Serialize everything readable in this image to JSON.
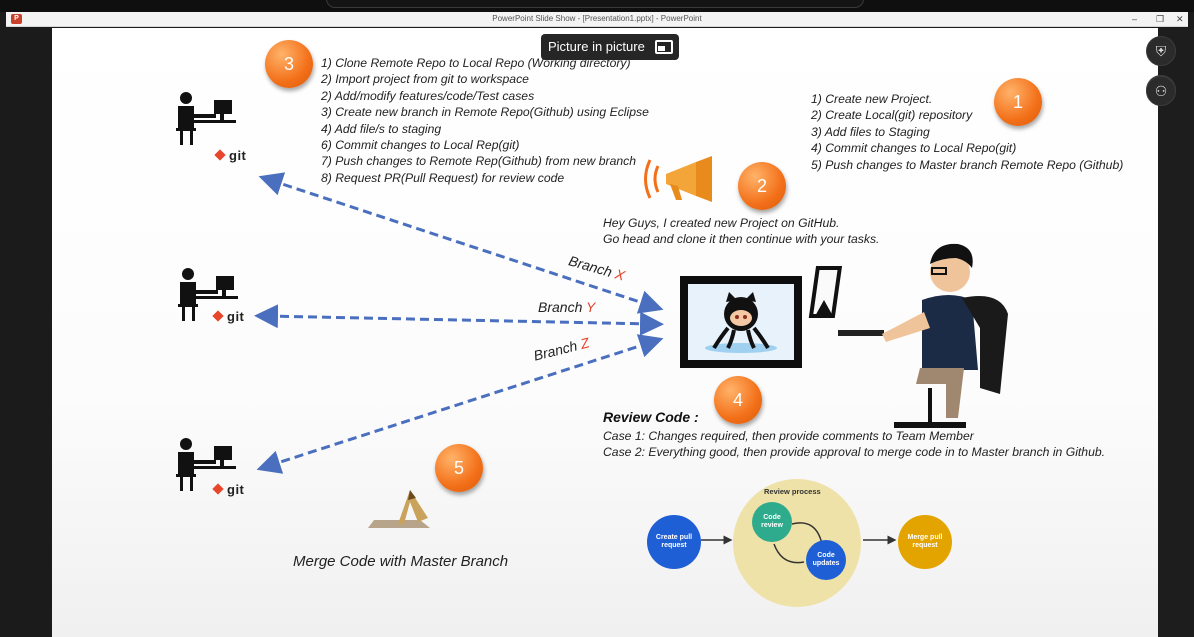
{
  "window": {
    "title": "PowerPoint Slide Show - [Presentation1.pptx] - PowerPoint",
    "app_icon_letter": "P"
  },
  "pip_button": {
    "label": "Picture in picture",
    "icon": "picture-in-picture-icon"
  },
  "side_buttons": [
    {
      "icon": "shield-icon"
    },
    {
      "icon": "plus-icon"
    },
    {
      "icon": "user-add-icon"
    }
  ],
  "slide": {
    "badges": [
      "1",
      "2",
      "3",
      "4",
      "5"
    ],
    "steps_right": [
      "1) Create new Project.",
      "2) Create Local(git) repository",
      "3) Add files to Staging",
      "4) Commit changes to Local Repo(git)",
      "5) Push changes to Master branch Remote Repo (Github)"
    ],
    "steps_left": [
      "1) Clone Remote Repo to Local Repo (Working directory)",
      "2) Import project from git to workspace",
      "2) Add/modify features/code/Test cases",
      "3) Create new branch in Remote Repo(Github) using Eclipse",
      "4) Add file/s to staging",
      "6) Commit changes to Local Rep(git)",
      "7) Push changes to Remote Rep(Github) from new branch",
      "8) Request PR(Pull Request) for review code"
    ],
    "announcement": [
      "Hey Guys, I created new Project on GitHub.",
      "Go head and clone it then continue with your tasks."
    ],
    "git_label": "git",
    "branches": [
      {
        "word": "Branch",
        "letter": "X"
      },
      {
        "word": "Branch",
        "letter": "Y"
      },
      {
        "word": "Branch",
        "letter": "Z"
      }
    ],
    "review": {
      "title": "Review Code :",
      "cases": [
        "Case 1: Changes required, then provide comments to Team Member",
        "Case 2: Everything good, then provide approval to merge code in to Master branch in Github."
      ]
    },
    "merge_text": "Merge Code with Master Branch",
    "process": {
      "title": "Review process",
      "create": "Create pull request",
      "review": "Code review",
      "updates": "Code updates",
      "merge": "Merge pull request"
    }
  },
  "colors": {
    "badge": "#f37019",
    "arrow": "#4a6fbf",
    "branch_letter": "#e2452f",
    "proc_blue": "#1f5fd6",
    "proc_teal": "#2eab8c",
    "proc_gold": "#e4a400",
    "review_bg": "#efe2a8"
  }
}
